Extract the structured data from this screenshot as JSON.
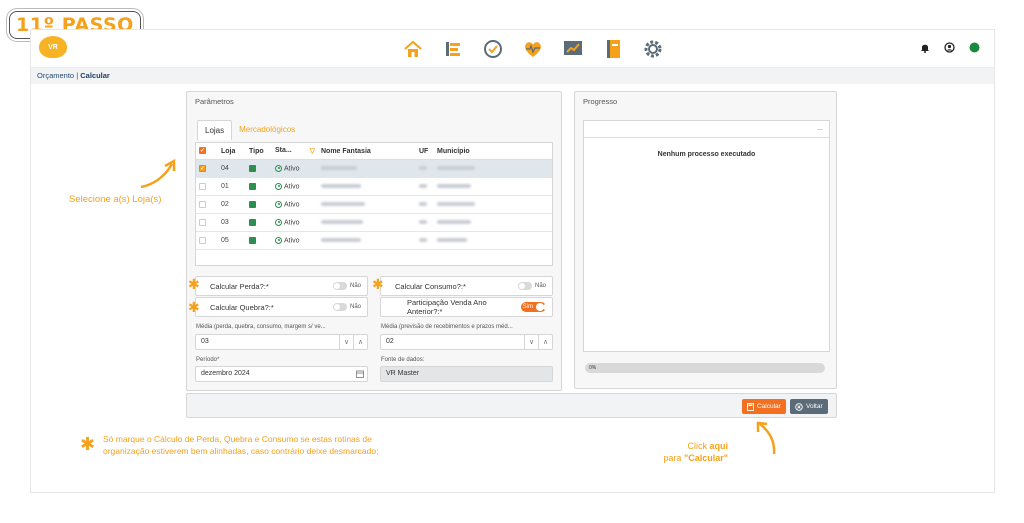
{
  "step": "11º PASSO",
  "logo_text": "VR",
  "breadcrumb": {
    "parent": "Orçamento",
    "current": "Calcular"
  },
  "params": {
    "title": "Parâmetros",
    "tabs": [
      {
        "label": "Lojas"
      },
      {
        "label": "Mercadológicos"
      }
    ],
    "table": {
      "headers": [
        "Loja",
        "Tipo",
        "Sta...",
        "Nome Fantasia",
        "UF",
        "Município"
      ],
      "rows": [
        {
          "loja": "04",
          "status": "Ativo",
          "selected": true
        },
        {
          "loja": "01",
          "status": "Ativo",
          "selected": false
        },
        {
          "loja": "02",
          "status": "Ativo",
          "selected": false
        },
        {
          "loja": "03",
          "status": "Ativo",
          "selected": false
        },
        {
          "loja": "05",
          "status": "Ativo",
          "selected": false
        }
      ]
    },
    "toggles": {
      "perda": {
        "label": "Calcular Perda?:*",
        "state": "Não"
      },
      "quebra": {
        "label": "Calcular Quebra?:*",
        "state": "Não"
      },
      "consumo": {
        "label": "Calcular Consumo?:*",
        "state": "Não"
      },
      "participacao": {
        "label": "Participação Venda Ano Anterior?:*",
        "state": "Sim"
      }
    },
    "fields": {
      "media1": {
        "label": "Média (perda, quebra, consumo, margem s/ ve...",
        "value": "03"
      },
      "media2": {
        "label": "Média (previsão de recebimentos e prazos méd...",
        "value": "02"
      },
      "periodo": {
        "label": "Período*",
        "value": "dezembro 2024"
      },
      "fonte": {
        "label": "Fonte de dados:",
        "value": "VR Master"
      }
    }
  },
  "progress": {
    "title": "Progresso",
    "menu": "...",
    "empty_text": "Nenhum processo executado",
    "percent_label": "0%",
    "percent": 0
  },
  "buttons": {
    "calcular": "Calcular",
    "voltar": "Voltar"
  },
  "annotations": {
    "select_store": "Selecione a(s) Loja(s)",
    "note_line1": "Só marque o Cálculo de Perda, Quebra e Consumo se estas rotinas de",
    "note_line2": "organização estiverem bem alinhadas, caso contrário deixe desmarcado;",
    "click_prefix": "Click ",
    "click_bold": "aqui",
    "click_line2_prefix": "para ",
    "click_line2_bold": "\"Calcular\""
  },
  "colors": {
    "accent": "#f5a11c",
    "button_orange": "#f37021",
    "active_green": "#2c8f4f"
  }
}
